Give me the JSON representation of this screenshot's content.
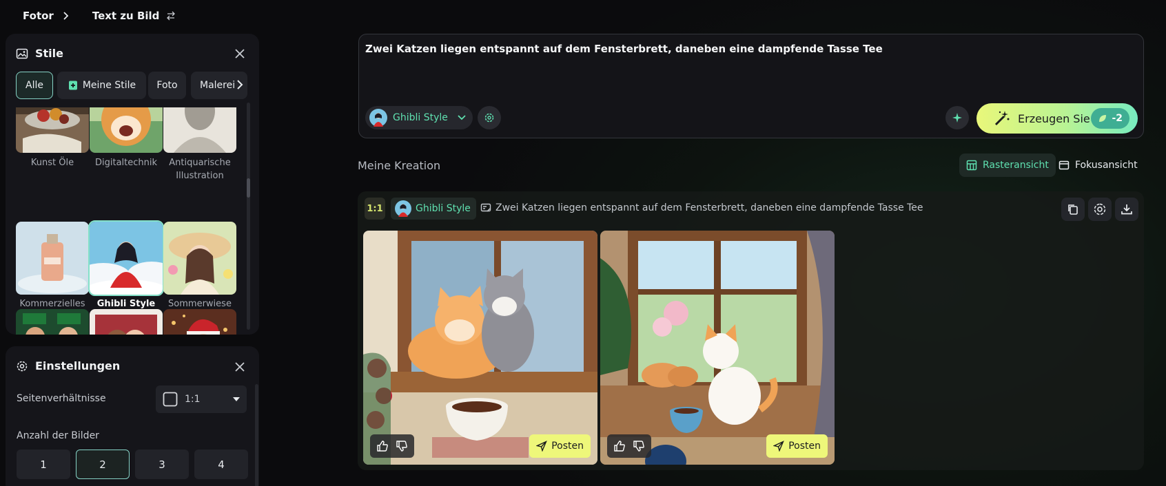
{
  "breadcrumb": {
    "home": "Fotor",
    "current": "Text zu Bild"
  },
  "styles_panel": {
    "title": "Stile",
    "chips": [
      "Alle",
      "Meine Stile",
      "Foto",
      "Malerei"
    ],
    "rows": [
      [
        {
          "label": "Kunst Öle"
        },
        {
          "label": "Digitaltechnik"
        },
        {
          "label": "Antiquarische Illustration"
        }
      ],
      [
        {
          "label": "Kommerzielles Produkt"
        },
        {
          "label": "Ghibli Style"
        },
        {
          "label": "Sommerwiese"
        }
      ]
    ],
    "selected": "Ghibli Style"
  },
  "settings_panel": {
    "title": "Einstellungen",
    "aspect_label": "Seitenverhältnisse",
    "aspect_value": "1:1",
    "count_label": "Anzahl der Bilder",
    "counts": [
      "1",
      "2",
      "3",
      "4"
    ],
    "selected_count": "2"
  },
  "prompt": {
    "text": "Zwei Katzen liegen entspannt auf dem Fensterbrett, daneben eine dampfende Tasse Tee",
    "style": "Ghibli Style",
    "generate_label": "Erzeugen Sie",
    "credit": "-2"
  },
  "creations": {
    "title": "Meine Kreation",
    "grid_view": "Rasteransicht",
    "focus_view": "Fokusansicht",
    "card": {
      "ratio": "1:1",
      "style": "Ghibli Style",
      "prompt": "Zwei Katzen liegen entspannt auf dem Fensterbrett, daneben eine dampfende Tasse Tee",
      "post_label": "Posten"
    }
  },
  "colors": {
    "accent": "#5fe0b0",
    "generate_start": "#e9f77a",
    "generate_end": "#77ecc0",
    "post": "#eef77a"
  }
}
